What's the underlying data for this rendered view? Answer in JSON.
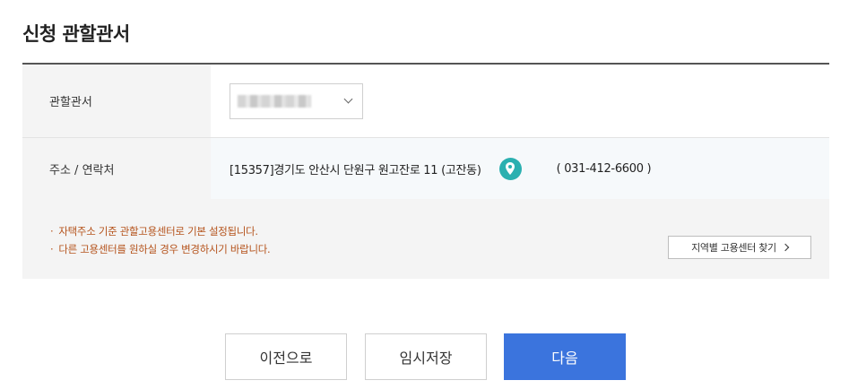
{
  "page": {
    "title": "신청 관할관서"
  },
  "form": {
    "office_label": "관할관서",
    "office_select": {
      "value": ""
    },
    "address_label": "주소 / 연락처",
    "address": "[15357]경기도 안산시 단원구 원고잔로 11 (고잔동)",
    "phone": "( 031-412-6600 )"
  },
  "notice": {
    "items": [
      "자택주소 기준 관할고용센터로 기본 설정됩니다.",
      "다른 고용센터를 원하실 경우 변경하시기 바랍니다."
    ],
    "bullet": "·",
    "find_button_label": "지역별 고용센터 찾기"
  },
  "footer": {
    "prev_label": "이전으로",
    "temp_save_label": "임시저장",
    "next_label": "다음"
  },
  "colors": {
    "accent": "#3b74dd",
    "notice_text": "#b5531c",
    "map_pin": "#2bb0b0"
  },
  "icons": [
    "chevron-down-icon",
    "map-pin-icon",
    "chevron-right-icon"
  ]
}
